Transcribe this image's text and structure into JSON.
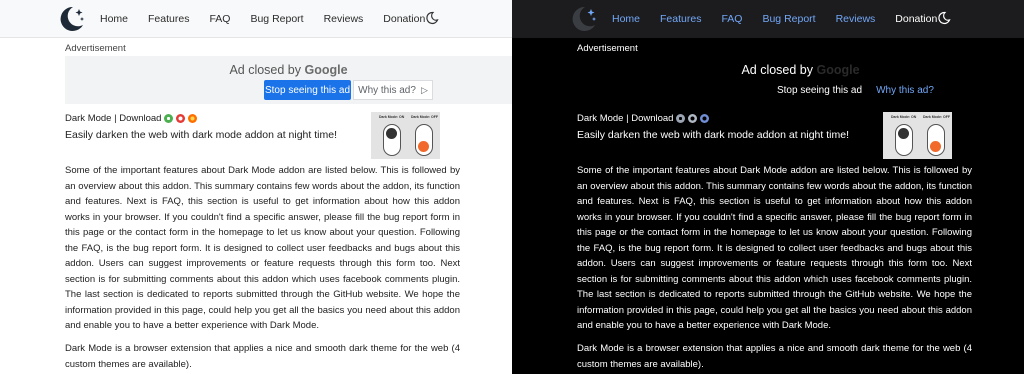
{
  "nav": {
    "items": [
      "Home",
      "Features",
      "FAQ",
      "Bug Report",
      "Reviews",
      "Donation"
    ],
    "logo": "crescent-moon-stars-icon",
    "theme_toggle": "moon-icon"
  },
  "ad": {
    "label": "Advertisement",
    "closed_text": "Ad closed by",
    "google": "Google",
    "stop_button": "Stop seeing this ad",
    "why_button": "Why this ad?",
    "why_icon": "play-triangle-icon"
  },
  "addon": {
    "title": "Dark Mode | Download",
    "tagline": "Easily darken the web with dark mode addon at night time!",
    "browser_icons": [
      "chrome-icon",
      "opera-icon",
      "firefox-icon"
    ],
    "preview_labels": [
      "Dark Mode: ON",
      "Dark Mode: OFF"
    ]
  },
  "content": {
    "paragraph1": "Some of the important features about Dark Mode addon are listed below. This is followed by an overview about this addon. This summary contains few words about the addon, its function and features. Next is FAQ, this section is useful to get information about how this addon works in your browser. If you couldn't find a specific answer, please fill the bug report form in this page or the contact form in the homepage to let us know about your question. Following the FAQ, is the bug report form. It is designed to collect user feedbacks and bugs about this addon. Users can suggest improvements or feature requests through this form too. Next section is for submitting comments about this addon which uses facebook comments plugin. The last section is dedicated to reports submitted through the GitHub website. We hope the information provided in this page, could help you get all the basics you need about this addon and enable you to have a better experience with Dark Mode.",
    "paragraph2": "Dark Mode is a browser extension that applies a nice and smooth dark theme for the web (4 custom themes are available)."
  },
  "colors": {
    "light_bg": "#ffffff",
    "dark_bg": "#000000",
    "dark_link": "#72a7f7",
    "ad_button_blue": "#1a73e8",
    "toggle_orange": "#f26a2b"
  }
}
